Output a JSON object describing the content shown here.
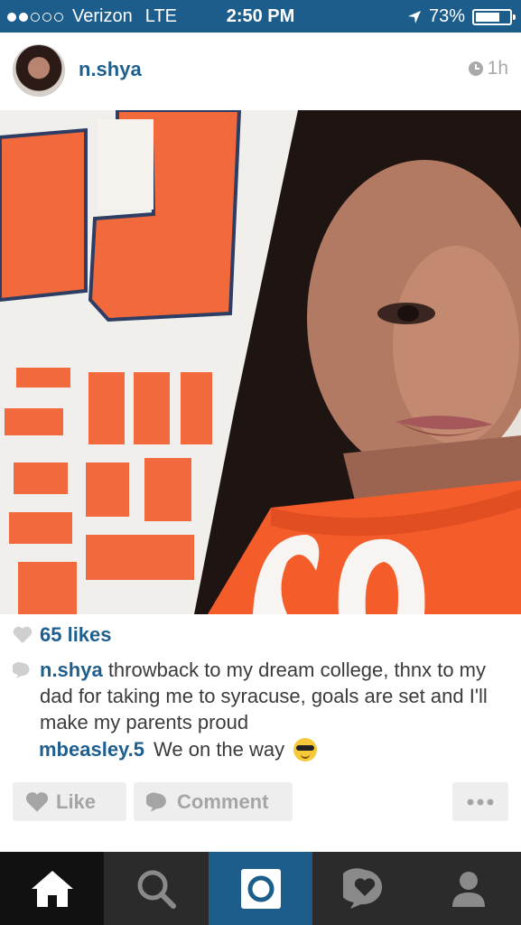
{
  "status": {
    "carrier": "Verizon",
    "network": "LTE",
    "time": "2:50 PM",
    "battery_text": "73%",
    "battery_level": 0.73,
    "signal_bars": 2
  },
  "post": {
    "username": "n.shya",
    "time_ago": "1h",
    "likes": "65 likes",
    "caption_user": "n.shya",
    "caption": " throwback to my dream college, thnx to my dad for taking me to syracuse, goals are set and I'll make my parents proud",
    "comment_user": "mbeasley.5",
    "comment_text": "We on the way"
  },
  "actions": {
    "like": "Like",
    "comment": "Comment"
  },
  "tabs": [
    {
      "name": "home",
      "icon": "home-icon",
      "active": true
    },
    {
      "name": "explore",
      "icon": "search-icon"
    },
    {
      "name": "camera",
      "icon": "camera-icon"
    },
    {
      "name": "activity",
      "icon": "activity-icon"
    },
    {
      "name": "profile",
      "icon": "profile-icon"
    }
  ],
  "colors": {
    "header_blue": "#1c5d8c",
    "link_blue": "#1f5f8e",
    "orange": "#f45c2a"
  }
}
